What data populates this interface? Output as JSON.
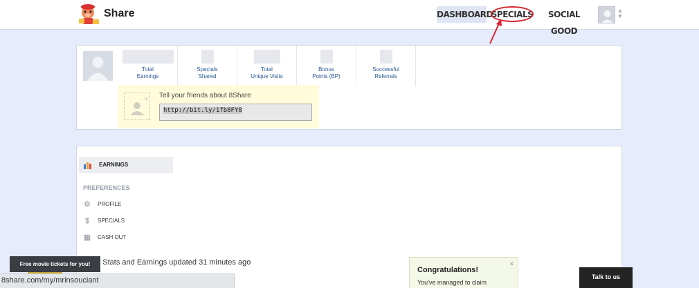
{
  "header": {
    "brand": "Share",
    "nav": {
      "dashboard": "DASHBOARD",
      "specials": "SPECIALS",
      "social_good": "SOCIAL GOOD"
    },
    "annotation_color": "#d9232e"
  },
  "profile": {
    "stats": [
      {
        "label": "Total\nEarnings"
      },
      {
        "label": "Specials\nShared"
      },
      {
        "label": "Total\nUnique Visits"
      },
      {
        "label": "Bonus\nPoints (BP)"
      },
      {
        "label": "Successful\nReferrals"
      }
    ],
    "invite": {
      "title": "Tell your friends about 8Share",
      "link": "http://bit.ly/1fb8FY8"
    }
  },
  "sidebar": {
    "earnings": "EARNINGS",
    "preferences_heading": "PREFERENCES",
    "items": [
      {
        "label": "PROFILE",
        "icon": "gear-icon"
      },
      {
        "label": "SPECIALS",
        "icon": "dollar-icon"
      },
      {
        "label": "CASH OUT",
        "icon": "cash-register-icon"
      }
    ]
  },
  "main": {
    "stats_updated": "Your Stats and Earnings updated 31 minutes ago"
  },
  "notification": {
    "title": "Congratulations!",
    "body": "You've managed to claim",
    "close": "×"
  },
  "talk_button": "Talk to us",
  "promo": "Free movie tickets for you!",
  "status_bar_url": "8share.com/my/mrinsouciant"
}
